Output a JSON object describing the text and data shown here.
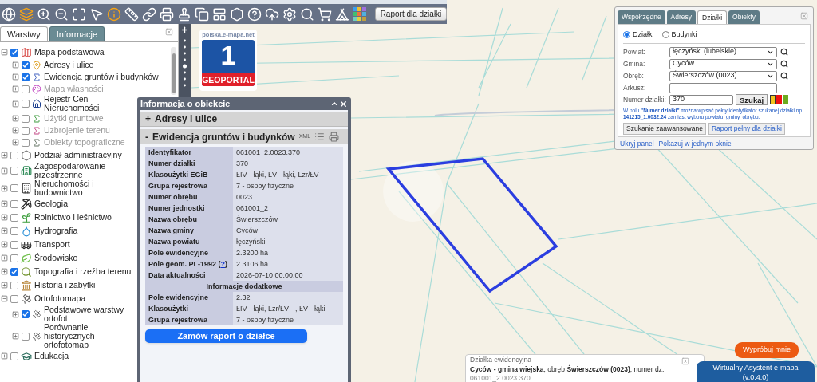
{
  "toolbar": {
    "report_button": "Raport dla działki"
  },
  "layers_panel": {
    "tabs": [
      {
        "label": "Warstwy",
        "selected": true
      },
      {
        "label": "Informacje",
        "selected": false
      }
    ],
    "layers": [
      {
        "label": "Mapa podstawowa",
        "checked": true,
        "expanded": true,
        "disabled": false,
        "children": [
          {
            "label": "Adresy i ulice",
            "checked": true,
            "expanded": false,
            "disabled": false
          },
          {
            "label": "Ewidencja gruntów i budynków",
            "checked": true,
            "expanded": false,
            "disabled": false
          },
          {
            "label": "Mapa własności",
            "checked": false,
            "expanded": false,
            "disabled": true
          },
          {
            "label": "Rejestr Cen Nieruchomości",
            "checked": false,
            "expanded": false,
            "disabled": false
          },
          {
            "label": "Użytki gruntowe",
            "checked": false,
            "expanded": false,
            "disabled": true
          },
          {
            "label": "Uzbrojenie terenu",
            "checked": false,
            "expanded": false,
            "disabled": true
          },
          {
            "label": "Obiekty topograficzne",
            "checked": false,
            "expanded": false,
            "disabled": true
          }
        ]
      },
      {
        "label": "Podział administracyjny",
        "checked": false,
        "expanded": false,
        "disabled": false
      },
      {
        "label": "Zagospodarowanie przestrzenne",
        "checked": false,
        "expanded": false,
        "disabled": false
      },
      {
        "label": "Nieruchomości i budownictwo",
        "checked": false,
        "expanded": false,
        "disabled": false
      },
      {
        "label": "Geologia",
        "checked": false,
        "expanded": false,
        "disabled": false
      },
      {
        "label": "Rolnictwo i leśnictwo",
        "checked": false,
        "expanded": false,
        "disabled": false
      },
      {
        "label": "Hydrografia",
        "checked": false,
        "expanded": false,
        "disabled": false
      },
      {
        "label": "Transport",
        "checked": false,
        "expanded": false,
        "disabled": false
      },
      {
        "label": "Środowisko",
        "checked": false,
        "expanded": false,
        "disabled": false
      },
      {
        "label": "Topografia i rzeźba terenu",
        "checked": true,
        "expanded": false,
        "disabled": false
      },
      {
        "label": "Historia i zabytki",
        "checked": false,
        "expanded": false,
        "disabled": false
      },
      {
        "label": "Ortofotomapa",
        "checked": false,
        "expanded": true,
        "disabled": false,
        "children": [
          {
            "label": "Podstawowe warstwy ortofot",
            "checked": true,
            "expanded": false,
            "disabled": false
          },
          {
            "label": "Porównanie historycznych ortofotomap",
            "checked": false,
            "expanded": false,
            "disabled": false
          }
        ]
      },
      {
        "label": "Edukacja",
        "checked": false,
        "expanded": false,
        "disabled": false
      }
    ]
  },
  "logo": {
    "site": "polska.e-mapa.net",
    "number": "1",
    "name": "GEOPORTAL"
  },
  "info_window": {
    "title": "Informacja o obiekcie",
    "sections": [
      {
        "sign": "+",
        "label": "Adresy i ulice",
        "expanded": false
      },
      {
        "sign": "-",
        "label": "Ewidencja gruntów i budynków",
        "expanded": true,
        "format": "XML"
      }
    ],
    "rows": [
      {
        "label": "Identyfikator",
        "value": "061001_2.0023.370"
      },
      {
        "label": "Numer działki",
        "value": "370"
      },
      {
        "label": "Klasoużytki EGiB",
        "value": "ŁIV - łąki, ŁV - łąki, Lzr/ŁV -"
      },
      {
        "label": "Grupa rejestrowa",
        "value": "7 - osoby fizyczne"
      },
      {
        "label": "Numer obrębu",
        "value": "0023"
      },
      {
        "label": "Numer jednostki",
        "value": "061001_2"
      },
      {
        "label": "Nazwa obrębu",
        "value": "Świerszczów"
      },
      {
        "label": "Nazwa gminy",
        "value": "Cyców"
      },
      {
        "label": "Nazwa powiatu",
        "value": "łęczyński"
      },
      {
        "label": "Pole ewidencyjne",
        "value": "2.3200 ha"
      },
      {
        "label": "Pole geom. PL-1992 (",
        "help": "?",
        "label_end": ")",
        "value": "2.3106 ha"
      },
      {
        "label": "Data aktualności",
        "value": "2026-07-10 00:00:00"
      }
    ],
    "extra_heading": "Informacje dodatkowe",
    "extra_rows": [
      {
        "label": "Pole ewidencyjne",
        "value": "2.32"
      },
      {
        "label": "Klasoużytki",
        "value": "ŁIV - łąki, Lzr/ŁV - , ŁV - łąki"
      },
      {
        "label": "Grupa rejestrowa",
        "value": "7 - osoby fizyczne"
      }
    ],
    "order_button": "Zamów raport o działce"
  },
  "search_panel": {
    "tabs": [
      {
        "label": "Współrzędne",
        "selected": false
      },
      {
        "label": "Adresy",
        "selected": false
      },
      {
        "label": "Działki",
        "selected": true
      },
      {
        "label": "Obiekty",
        "selected": false
      }
    ],
    "radios": [
      {
        "label": "Działki",
        "selected": true
      },
      {
        "label": "Budynki",
        "selected": false
      }
    ],
    "fields": [
      {
        "label": "Powiat:",
        "kind": "select",
        "value": "łęczyński (lubelskie)"
      },
      {
        "label": "Gmina:",
        "kind": "select",
        "value": "Cyców"
      },
      {
        "label": "Obręb:",
        "kind": "select",
        "value": "Świerszczów (0023)"
      },
      {
        "label": "Arkusz:",
        "kind": "text"
      },
      {
        "label": "Numer działki:",
        "kind": "number",
        "value": "370"
      }
    ],
    "search_button": "Szukaj",
    "colors": [
      {
        "color": "#f2c31b",
        "selected": true
      },
      {
        "color": "#ee1111",
        "selected": false
      },
      {
        "color": "#6cab1f",
        "selected": false
      }
    ],
    "hint": "W polu **\"Numer działki\"** można wpisać pełny identyfikator szukanej działki np. **141215_1.0032.24** zamiast wyboru powiatu, gminy, obrębu.",
    "buttons": [
      {
        "label": "Szukanie zaawansowane",
        "kind": "plain"
      },
      {
        "label": "Raport pełny dla działki",
        "kind": "link"
      }
    ],
    "links": [
      "Ukryj panel",
      "Pokazuj w jednym oknie"
    ]
  },
  "parcel_tooltip": {
    "title": "Działka ewidencyjna",
    "description": "**Cyców - gmina wiejska**, obręb **Świerszczów (0023)**, numer dz.",
    "id": "061001_2.0023.370"
  },
  "assistant": {
    "bubble": "Wypróbuj mnie",
    "title": "Wirtualny Asystent e-mapa",
    "version": "(v.0.4.0)"
  }
}
